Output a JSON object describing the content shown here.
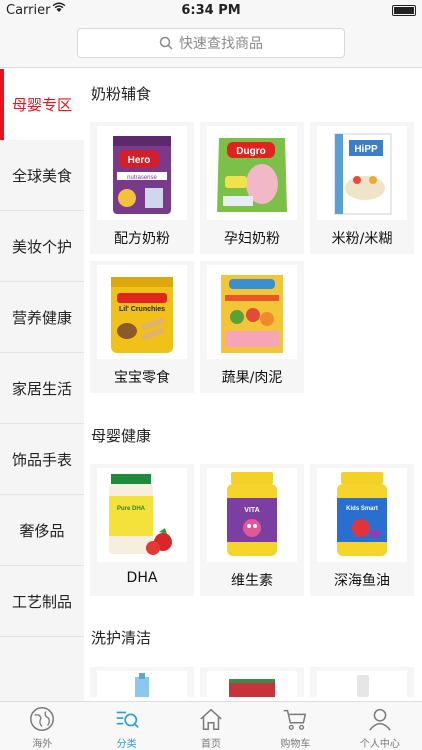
{
  "status_bar": {
    "carrier": "Carrier",
    "time": "6:34 PM"
  },
  "search": {
    "placeholder": "快速查找商品"
  },
  "sidebar": {
    "items": [
      {
        "label": "母婴专区",
        "active": true
      },
      {
        "label": "全球美食"
      },
      {
        "label": "美妆个护"
      },
      {
        "label": "营养健康"
      },
      {
        "label": "家居生活"
      },
      {
        "label": "饰品手表"
      },
      {
        "label": "奢侈品"
      },
      {
        "label": "工艺制品"
      }
    ]
  },
  "sections": [
    {
      "title": "奶粉辅食",
      "items": [
        "配方奶粉",
        "孕妇奶粉",
        "米粉/米糊",
        "宝宝零食",
        "蔬果/肉泥"
      ]
    },
    {
      "title": "母婴健康",
      "items": [
        "DHA",
        "维生素",
        "深海鱼油"
      ]
    },
    {
      "title": "洗护清洁"
    }
  ],
  "tab_bar": {
    "tabs": [
      {
        "label": "海外"
      },
      {
        "label": "分类",
        "active": true
      },
      {
        "label": "首页"
      },
      {
        "label": "购物车"
      },
      {
        "label": "个人中心"
      }
    ]
  },
  "colors": {
    "accent_red": "#e8131d",
    "tab_active": "#2f9de0"
  },
  "product_images": {
    "hero_baby": "Hero Baby nutrasense",
    "dugro": "Dugro Mama",
    "hipp": "HiPP",
    "gerber_crunchies": "Lil' Crunchies",
    "childlife": "ChildLife Pure DHA",
    "natures_way_1": "Nature's Way VITA Gummies",
    "natures_way_2": "Nature's Way Kids Smart VITA Gummies"
  }
}
